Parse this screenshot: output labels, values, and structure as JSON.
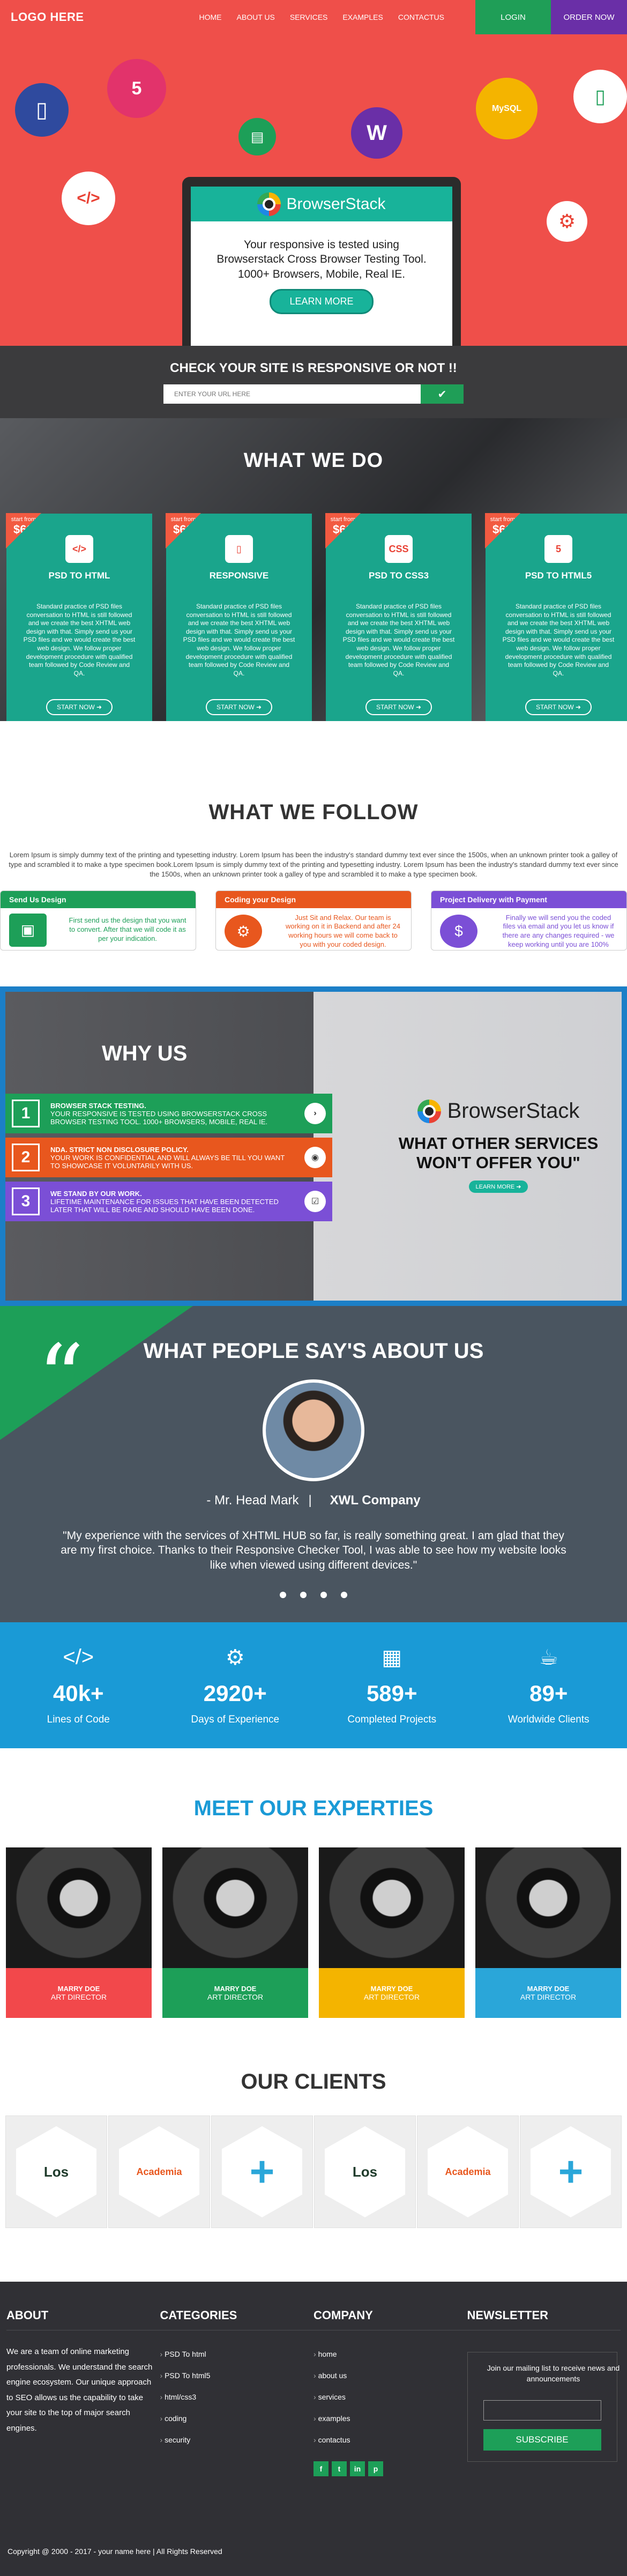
{
  "nav": {
    "logo": "LOGO HERE",
    "items": [
      "HOME",
      "ABOUT US",
      "SERVICES",
      "EXAMPLES",
      "CONTACTUS"
    ],
    "login": "LOGIN",
    "order": "ORDER NOW"
  },
  "hero": {
    "brand": "BrowserStack",
    "text": "Your responsive is tested using Browserstack Cross Browser Testing Tool. 1000+ Browsers, Mobile, Real IE.",
    "learn": "LEARN MORE",
    "icons": [
      "mobile-icon",
      "html5-icon",
      "printer-icon",
      "wordpress-icon",
      "mysql-icon",
      "phone-icon",
      "code-icon",
      "settings-icon"
    ],
    "icon_labels": {
      "html5": "5",
      "mysql": "MySQL"
    }
  },
  "check": {
    "title": "CHECK YOUR SITE IS  RESPONSIVE OR NOT !!",
    "placeholder": "ENTER YOUR URL HERE"
  },
  "wwd": {
    "title": "WHAT WE DO",
    "badge_from": "start from",
    "cards": [
      {
        "price": "$60",
        "title": "PSD TO HTML",
        "icon": "</>",
        "text": "Standard practice of PSD files conversation to HTML is still followed and we create the best XHTML web design with that. Simply send us your PSD files and we would create the best web design. We follow proper development procedure with qualified team followed by Code Review and QA.",
        "button": "START NOW"
      },
      {
        "price": "$60",
        "title": "RESPONSIVE",
        "icon": "▯",
        "text": "Standard practice of PSD files conversation to HTML is still followed and we create the best XHTML web design with that. Simply send us your PSD files and we would create the best web design. We follow proper development procedure with qualified team followed by Code Review and QA.",
        "button": "START NOW"
      },
      {
        "price": "$60",
        "title": "PSD TO CSS3",
        "icon": "CSS",
        "text": "Standard practice of PSD files conversation to HTML is still followed and we create the best XHTML web design with that. Simply send us your PSD files and we would create the best web design. We follow proper development procedure with qualified team followed by Code Review and QA.",
        "button": "START NOW"
      },
      {
        "price": "$60",
        "title": "PSD TO HTML5",
        "icon": "5",
        "text": "Standard practice of PSD files conversation to HTML is still followed and we create the best XHTML web design with that. Simply send us your PSD files and we would create the best web design. We follow proper development procedure with qualified team followed by Code Review and QA.",
        "button": "START NOW"
      }
    ]
  },
  "follow": {
    "title": "WHAT WE FOLLOW",
    "lorem": "Lorem Ipsum is simply dummy text of the printing and typesetting industry. Lorem Ipsum has been the industry's standard dummy text ever since the 1500s, when an unknown printer took a galley of type and scrambled it to make a type specimen book.Lorem Ipsum is simply dummy text of the printing and typesetting industry. Lorem Ipsum has been the industry's standard dummy text ever since the 1500s, when an unknown printer took a galley of type and scrambled it to make a type specimen book.",
    "boxes": [
      {
        "title": "Send Us Design",
        "text": "First send us the design that you want to convert. After that we will code it as per your indication.",
        "color": "#1d9f58",
        "icon": "▣"
      },
      {
        "title": "Coding your Design",
        "text": "Just Sit and Relax. Our team is working on it in Backend and after 24 working hours we will come back to you with your coded design.",
        "color": "#e8571e",
        "icon": "⚙"
      },
      {
        "title": "Project Delivery with Payment",
        "text": "Finally we will send you the coded files via email and you let us know if there are any changes required - we keep working until you are 100%",
        "color": "#7b4fd6",
        "icon": "$"
      }
    ]
  },
  "why": {
    "title": "WHY US",
    "rows": [
      {
        "num": "1",
        "head": "BROWSER STACK TESTING.",
        "text": "YOUR RESPONSIVE IS TESTED USING BROWSERSTACK CROSS BROWSER TESTING TOOL. 1000+ BROWSERS, MOBILE, REAL IE.",
        "color": "#1d9f58",
        "arrow": "›"
      },
      {
        "num": "2",
        "head": "NDA. STRICT NON DISCLOSURE POLICY.",
        "text": "YOUR WORK IS CONFIDENTIAL AND WILL ALWAYS BE TILL YOU WANT TO SHOWCASE IT VOLUNTARILY WITH US.",
        "color": "#e8571e",
        "arrow": "◉"
      },
      {
        "num": "3",
        "head": "WE STAND BY OUR WORK.",
        "text": "LIFETIME MAINTENANCE FOR ISSUES THAT HAVE BEEN DETECTED LATER THAT WILL BE RARE AND SHOULD HAVE BEEN DONE.",
        "color": "#7b4fd6",
        "arrow": "☑"
      }
    ],
    "brand": "BrowserStack",
    "tagline": "WHAT OTHER SERVICES WON'T OFFER YOU\"",
    "learn": "LEARN MORE"
  },
  "testimonial": {
    "title": "WHAT PEOPLE SAY'S ABOUT US",
    "name": "- Mr. Head Mark",
    "separator": "|",
    "company": "XWL Company",
    "quote": "\"My experience with the services of XHTML HUB so far, is really something great. I am glad that they are my first choice. Thanks to their Responsive Checker Tool, I was able to see how my website looks like when viewed using different devices.\""
  },
  "stats": [
    {
      "icon": "</>",
      "num": "40k+",
      "label": "Lines of Code"
    },
    {
      "icon": "⚙",
      "num": "2920+",
      "label": "Days of Experience"
    },
    {
      "icon": "▦",
      "num": "589+",
      "label": "Completed Projects"
    },
    {
      "icon": "☕",
      "num": "89+",
      "label": "Worldwide Clients"
    }
  ],
  "experts": {
    "title": "MEET OUR EXPERTIES",
    "members": [
      {
        "name": "MARRY DOE",
        "role": "ART DIRECTOR",
        "color": "#f2484b"
      },
      {
        "name": "MARRY DOE",
        "role": "ART DIRECTOR",
        "color": "#1d9f58"
      },
      {
        "name": "MARRY DOE",
        "role": "ART DIRECTOR",
        "color": "#f4b400"
      },
      {
        "name": "MARRY DOE",
        "role": "ART DIRECTOR",
        "color": "#2aa6d9"
      }
    ]
  },
  "clients": {
    "title": "OUR CLIENTS",
    "logos": [
      {
        "name": "Los",
        "color": "#1f3b2b"
      },
      {
        "name": "Academia",
        "color": "#e8571e"
      },
      {
        "name": "+",
        "color": "#2aa6d9"
      },
      {
        "name": "Los",
        "color": "#1f3b2b"
      },
      {
        "name": "Academia",
        "color": "#e8571e"
      },
      {
        "name": "+",
        "color": "#2aa6d9"
      }
    ]
  },
  "footer": {
    "about_title": "ABOUT",
    "about_text": "We are a team of online marketing professionals. We understand the search engine ecosystem. Our unique approach to SEO allows us the capability to take your site to the top of major search engines.",
    "cat_title": "CATEGORIES",
    "categories": [
      "PSD To html",
      "PSD To html5",
      "html/css3",
      "coding",
      "security"
    ],
    "company_title": "COMPANY",
    "company": [
      "home",
      "about us",
      "services",
      "examples",
      "contactus"
    ],
    "social": [
      "f",
      "t",
      "in",
      "p"
    ],
    "news_title": "NEWSLETTER",
    "news_text": "Join our mailing list to receive news and announcements",
    "subscribe": "SUBSCRIBE",
    "copyright": "Copyright @ 2000 - 2017 - your name here | All Rights Reserved"
  }
}
